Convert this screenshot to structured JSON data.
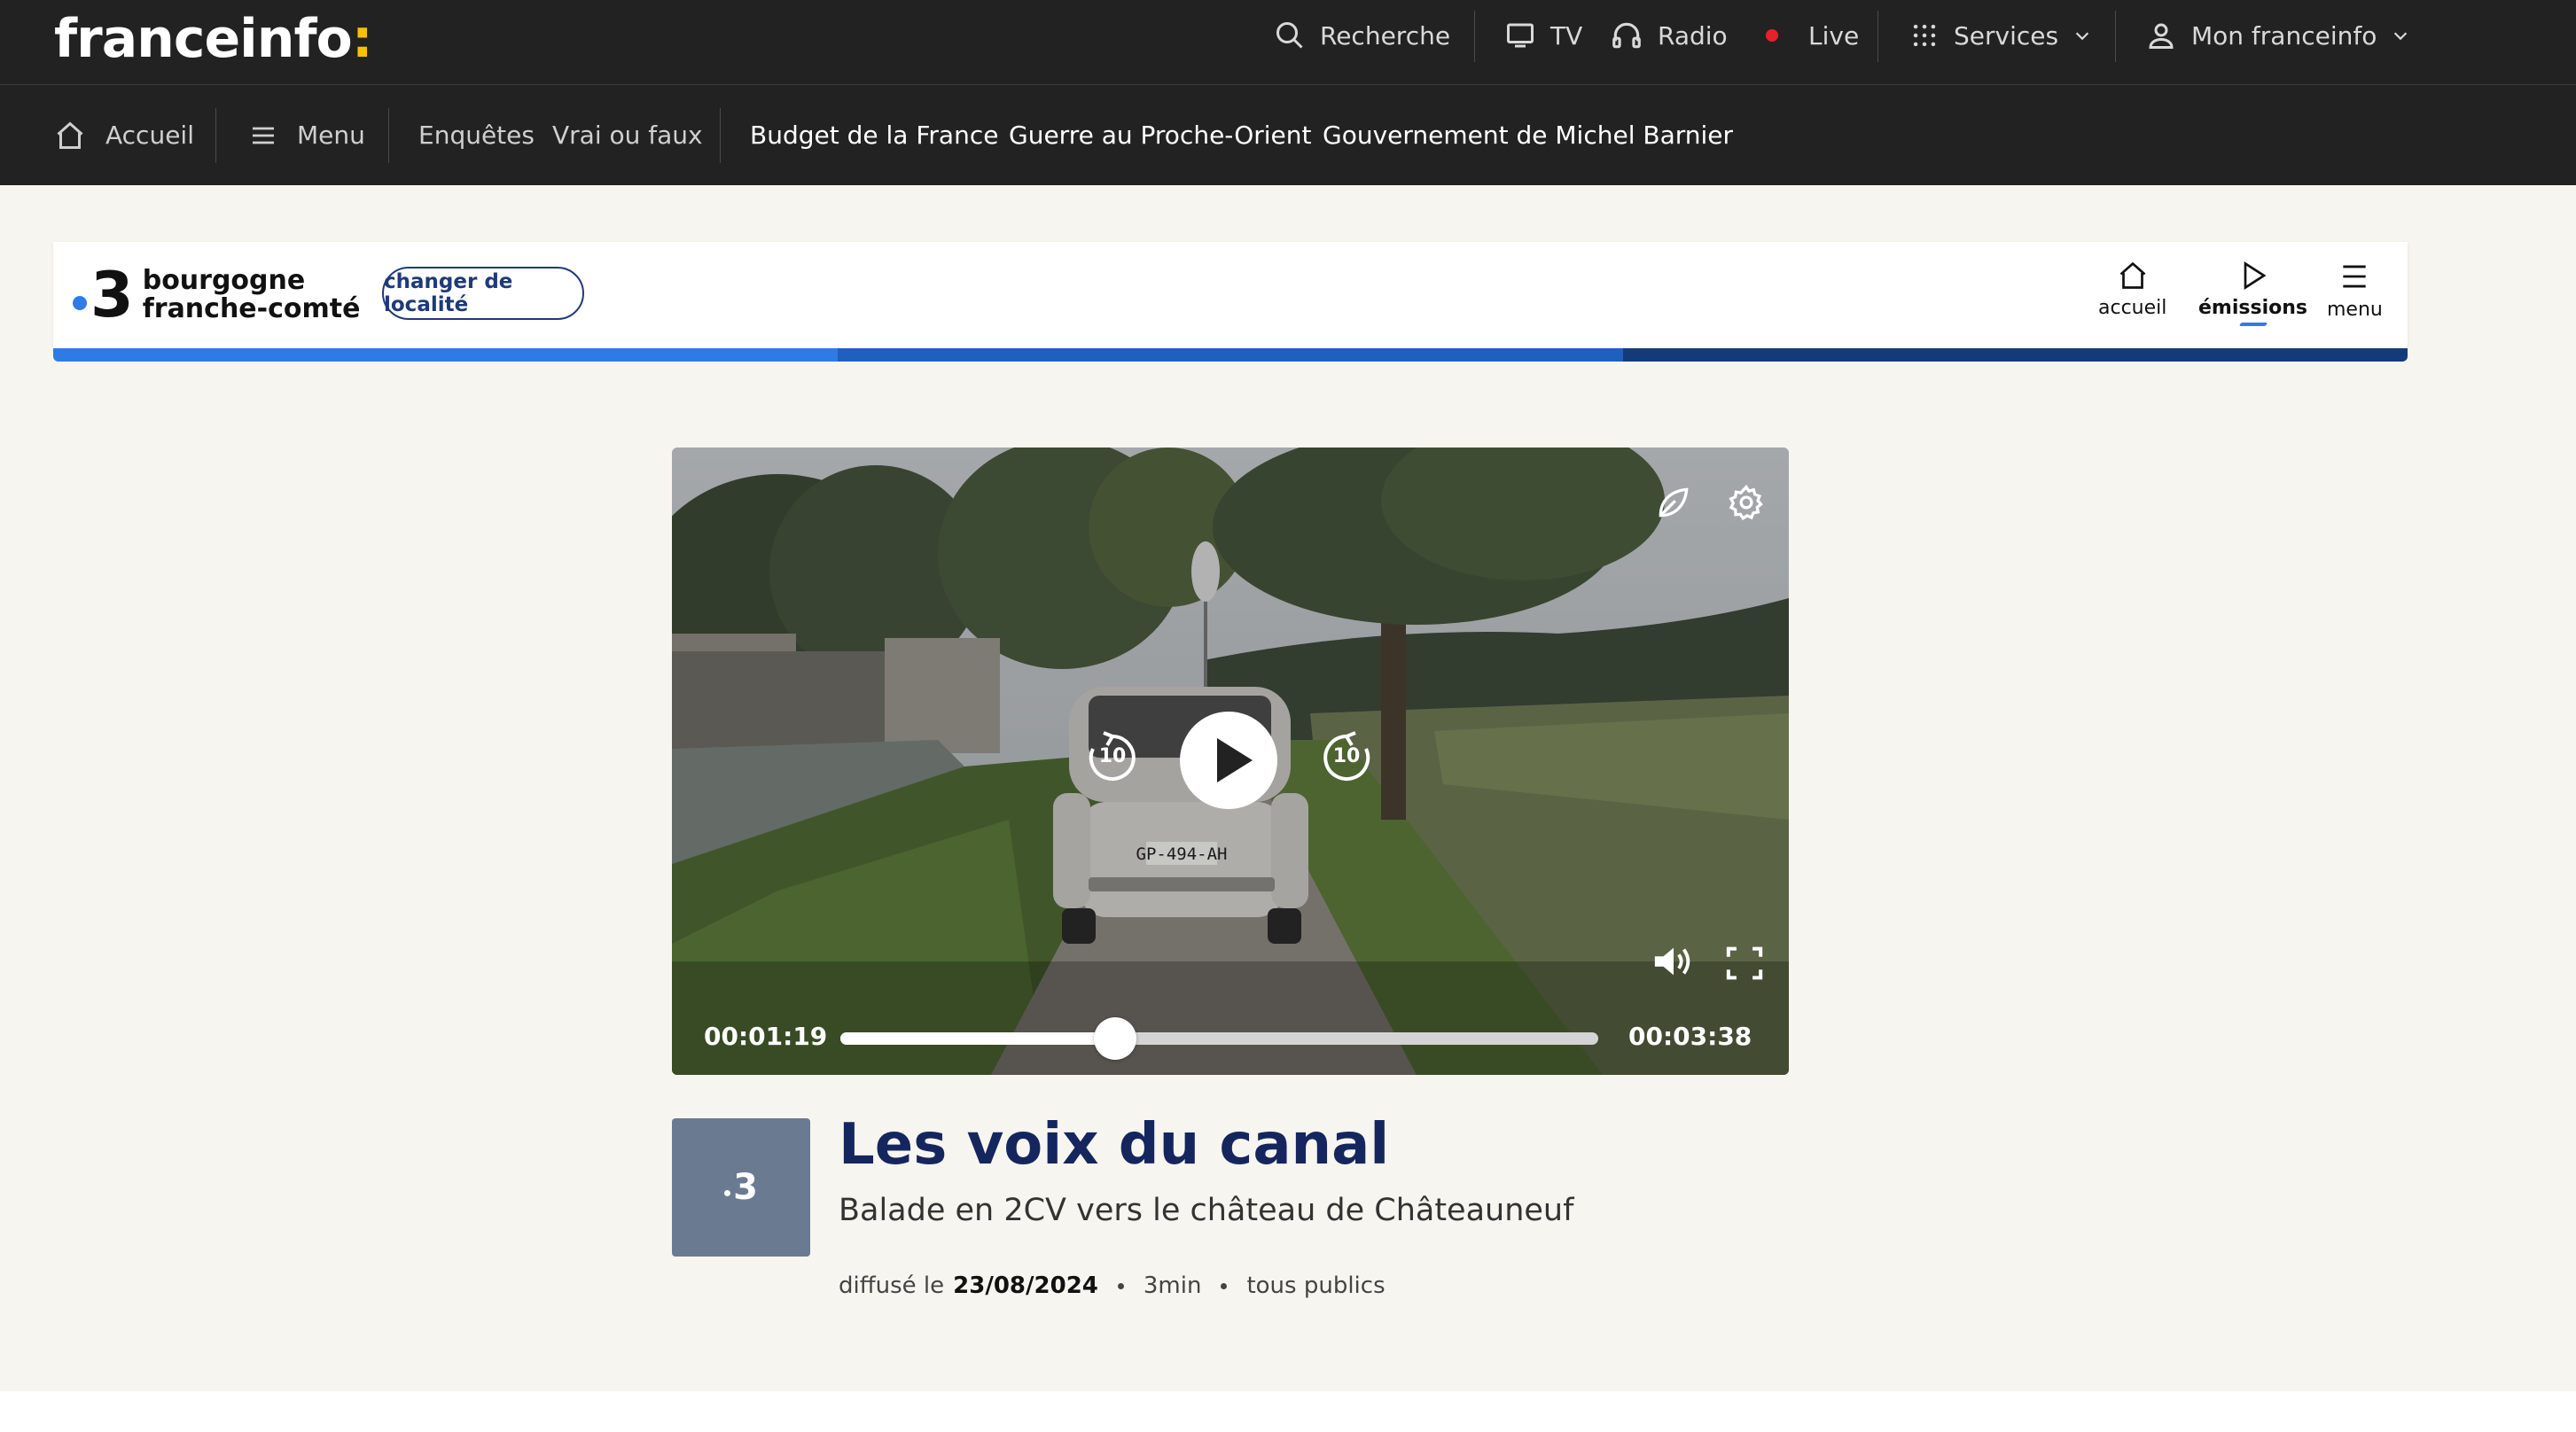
{
  "header": {
    "logo_text": "franceinfo",
    "logo_colon": ":",
    "search_label": "Recherche",
    "tv_label": "TV",
    "radio_label": "Radio",
    "live_label": "Live",
    "services_label": "Services",
    "account_label": "Mon franceinfo"
  },
  "subnav": {
    "home_label": "Accueil",
    "menu_label": "Menu",
    "links": [
      "Enquêtes",
      "Vrai ou faux"
    ],
    "topics": [
      "Budget de la France",
      "Guerre au Proche-Orient",
      "Gouvernement de Michel Barnier"
    ]
  },
  "regional": {
    "logo_number": "3",
    "region_line1": "bourgogne",
    "region_line2": "franche-comté",
    "change_location_label": "changer de localité",
    "nav": [
      "accueil",
      "émissions",
      "menu"
    ],
    "stripe_colors": [
      "#2f7be6",
      "#1f5fc0",
      "#143a7a"
    ]
  },
  "player": {
    "current_time": "00:01:19",
    "duration": "00:03:38",
    "progress_fraction": 0.362,
    "rewind_seconds": "10",
    "forward_seconds": "10",
    "plate": "GP-494-AH"
  },
  "program": {
    "channel_badge": "3",
    "title": "Les voix du canal",
    "subtitle": "Balade en 2CV vers le château de Châteauneuf",
    "aired_prefix": "diffusé le",
    "aired_date": "23/08/2024",
    "duration": "3min",
    "audience": "tous publics"
  }
}
